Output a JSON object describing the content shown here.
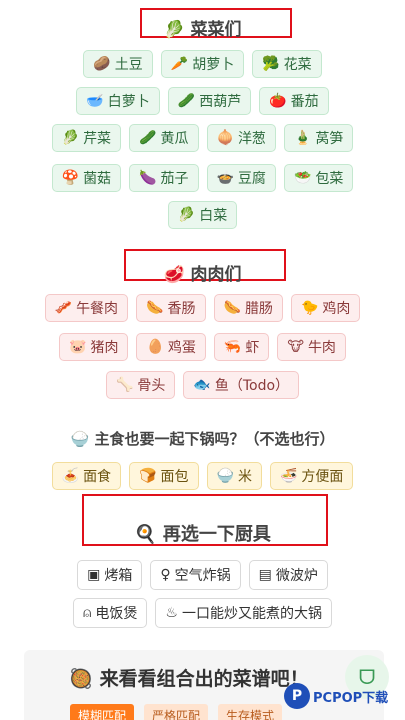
{
  "veg": {
    "title": "菜菜们",
    "title_icon": "🥬",
    "rows": [
      [
        {
          "icon": "🥔",
          "label": "土豆"
        },
        {
          "icon": "🥕",
          "label": "胡萝卜"
        },
        {
          "icon": "🥦",
          "label": "花菜"
        }
      ],
      [
        {
          "icon": "🥣",
          "label": "白萝卜"
        },
        {
          "icon": "🥒",
          "label": "西葫芦"
        },
        {
          "icon": "🍅",
          "label": "番茄"
        }
      ],
      [
        {
          "icon": "🥬",
          "label": "芹菜"
        },
        {
          "icon": "🥒",
          "label": "黄瓜"
        },
        {
          "icon": "🧅",
          "label": "洋葱"
        },
        {
          "icon": "🎍",
          "label": "莴笋"
        }
      ],
      [
        {
          "icon": "🍄",
          "label": "菌菇"
        },
        {
          "icon": "🍆",
          "label": "茄子"
        },
        {
          "icon": "🍲",
          "label": "豆腐"
        },
        {
          "icon": "🥗",
          "label": "包菜"
        }
      ],
      [
        {
          "icon": "🥬",
          "label": "白菜"
        }
      ]
    ]
  },
  "meat": {
    "title": "肉肉们",
    "title_icon": "🥩",
    "rows": [
      [
        {
          "icon": "🥓",
          "label": "午餐肉"
        },
        {
          "icon": "🌭",
          "label": "香肠"
        },
        {
          "icon": "🌭",
          "label": "腊肠"
        },
        {
          "icon": "🐤",
          "label": "鸡肉"
        }
      ],
      [
        {
          "icon": "🐷",
          "label": "猪肉"
        },
        {
          "icon": "🥚",
          "label": "鸡蛋"
        },
        {
          "icon": "🦐",
          "label": "虾"
        },
        {
          "icon": "🐮",
          "label": "牛肉"
        }
      ],
      [
        {
          "icon": "🦴",
          "label": "骨头"
        },
        {
          "icon": "🐟",
          "label": "鱼（Todo）"
        }
      ]
    ]
  },
  "staple": {
    "title": "主食也要一起下锅吗？（不选也行）",
    "title_icon": "🍚",
    "items": [
      {
        "icon": "🍝",
        "label": "面食"
      },
      {
        "icon": "🍞",
        "label": "面包"
      },
      {
        "icon": "🍚",
        "label": "米"
      },
      {
        "icon": "🍜",
        "label": "方便面"
      }
    ]
  },
  "tools": {
    "title": "再选一下厨具",
    "title_icon": "🍳",
    "rows": [
      [
        {
          "icon": "▣",
          "label": "烤箱"
        },
        {
          "icon": "♀",
          "label": "空气炸锅"
        },
        {
          "icon": "▤",
          "label": "微波炉"
        }
      ],
      [
        {
          "icon": "⍝",
          "label": "电饭煲"
        },
        {
          "icon": "♨",
          "label": "一口能炒又能煮的大锅"
        }
      ]
    ]
  },
  "recipe": {
    "title": "来看看组合出的菜谱吧！",
    "title_icon": "🥘",
    "modes": [
      "模糊匹配",
      "严格匹配",
      "生存模式"
    ]
  },
  "fab_icon": "ᗜ",
  "watermark": {
    "mark": "P",
    "text": "PCPOP下载"
  }
}
